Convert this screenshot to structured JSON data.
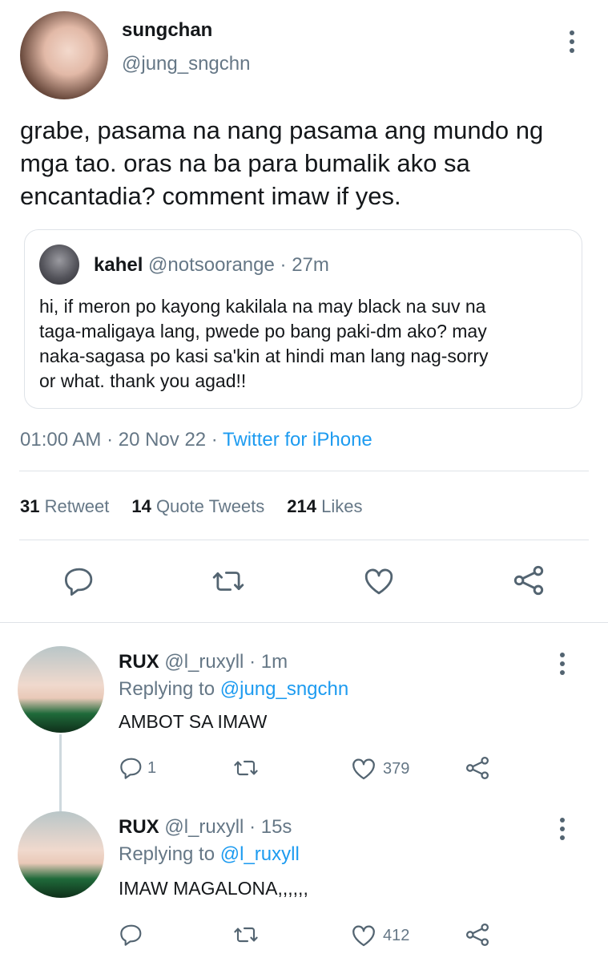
{
  "tweet": {
    "author_name": "sungchan",
    "author_handle": "@jung_sngchn",
    "text_lines": [
      "grabe, pasama na nang pasama ang mundo ng",
      "mga tao. oras na ba para bumalik ako sa",
      "encantadia? comment imaw if yes."
    ],
    "quoted": {
      "author_name": "kahel",
      "author_handle": "@notsoorange",
      "time": "· 27m",
      "text_lines": [
        "hi, if meron po kayong kakilala na may black na suv na",
        "taga-maligaya lang, pwede po bang paki-dm ako? may",
        "naka-sagasa po kasi sa'kin at hindi man lang nag-sorry",
        "or what. thank you agad!!"
      ]
    },
    "timestamp": "01:00 AM · 20 Nov 22 · ",
    "source": "Twitter for iPhone",
    "stats": {
      "retweets_count": "31",
      "retweets_label": "Retweet",
      "quotes_count": "14",
      "quotes_label": "Quote Tweets",
      "likes_count": "214",
      "likes_label": "Likes"
    },
    "actions": [
      "reply-icon",
      "retweet-icon",
      "like-icon",
      "share-icon"
    ]
  },
  "replies": [
    {
      "author_name": "RUX",
      "author_handle": "@l_ruxyll",
      "time": "· 1m",
      "replying_prefix": "Replying to ",
      "replying_handle": "@jung_sngchn",
      "text": "AMBOT SA IMAW",
      "reply_count": "1",
      "retweet_count": "",
      "like_count": "379"
    },
    {
      "author_name": "RUX",
      "author_handle": "@l_ruxyll",
      "time": "· 15s",
      "replying_prefix": "Replying to ",
      "replying_handle": "@l_ruxyll",
      "text": "IMAW MAGALONA,,,,,,",
      "reply_count": "",
      "retweet_count": "",
      "like_count": "412"
    }
  ],
  "colors": {
    "link": "#1d9bf0",
    "secondary_text": "#657786",
    "icon": "#536471"
  }
}
